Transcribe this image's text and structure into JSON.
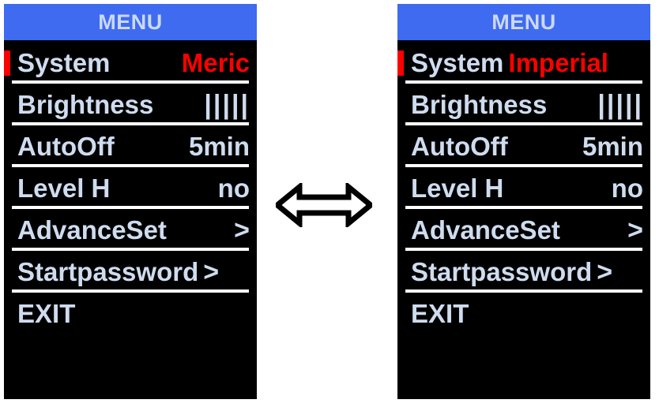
{
  "figure": {
    "kind": "device-screen-comparison",
    "center_icon": "double-headed-arrow"
  },
  "colors": {
    "screen_background": "#000000",
    "header_background": "#3e6bf0",
    "header_text": "#ccd8f7",
    "menu_text": "#cfdcef",
    "accent_value": "#ff0000",
    "selection_marker": "#ff0000",
    "separator": "#ffffff",
    "page_background": "#ffffff"
  },
  "panels": [
    {
      "id": "metric",
      "header": {
        "title": "MENU"
      },
      "rows": [
        {
          "label": "System",
          "value": "Meric",
          "accent": true,
          "selected": true,
          "separator": true
        },
        {
          "label": "Brightness",
          "value": "|||||",
          "accent": false,
          "selected": false,
          "separator": true
        },
        {
          "label": "AutoOff",
          "value": "5min",
          "accent": false,
          "selected": false,
          "separator": true
        },
        {
          "label": "Level H",
          "value": "no",
          "accent": false,
          "selected": false,
          "separator": true
        },
        {
          "label": "AdvanceSet",
          "value": ">",
          "accent": false,
          "selected": false,
          "separator": true
        },
        {
          "label": "Startpassword",
          "value": ">",
          "accent": false,
          "selected": false,
          "separator": true
        },
        {
          "label": "EXIT",
          "value": "",
          "accent": false,
          "selected": false,
          "separator": false
        }
      ]
    },
    {
      "id": "imperial",
      "header": {
        "title": "MENU"
      },
      "rows": [
        {
          "label": "System",
          "value": "Imperial",
          "accent": true,
          "selected": true,
          "separator": true
        },
        {
          "label": "Brightness",
          "value": "|||||",
          "accent": false,
          "selected": false,
          "separator": true
        },
        {
          "label": "AutoOff",
          "value": "5min",
          "accent": false,
          "selected": false,
          "separator": true
        },
        {
          "label": "Level H",
          "value": "no",
          "accent": false,
          "selected": false,
          "separator": true
        },
        {
          "label": "AdvanceSet",
          "value": ">",
          "accent": false,
          "selected": false,
          "separator": true
        },
        {
          "label": "Startpassword",
          "value": ">",
          "accent": false,
          "selected": false,
          "separator": true
        },
        {
          "label": "EXIT",
          "value": "",
          "accent": false,
          "selected": false,
          "separator": false
        }
      ]
    }
  ]
}
